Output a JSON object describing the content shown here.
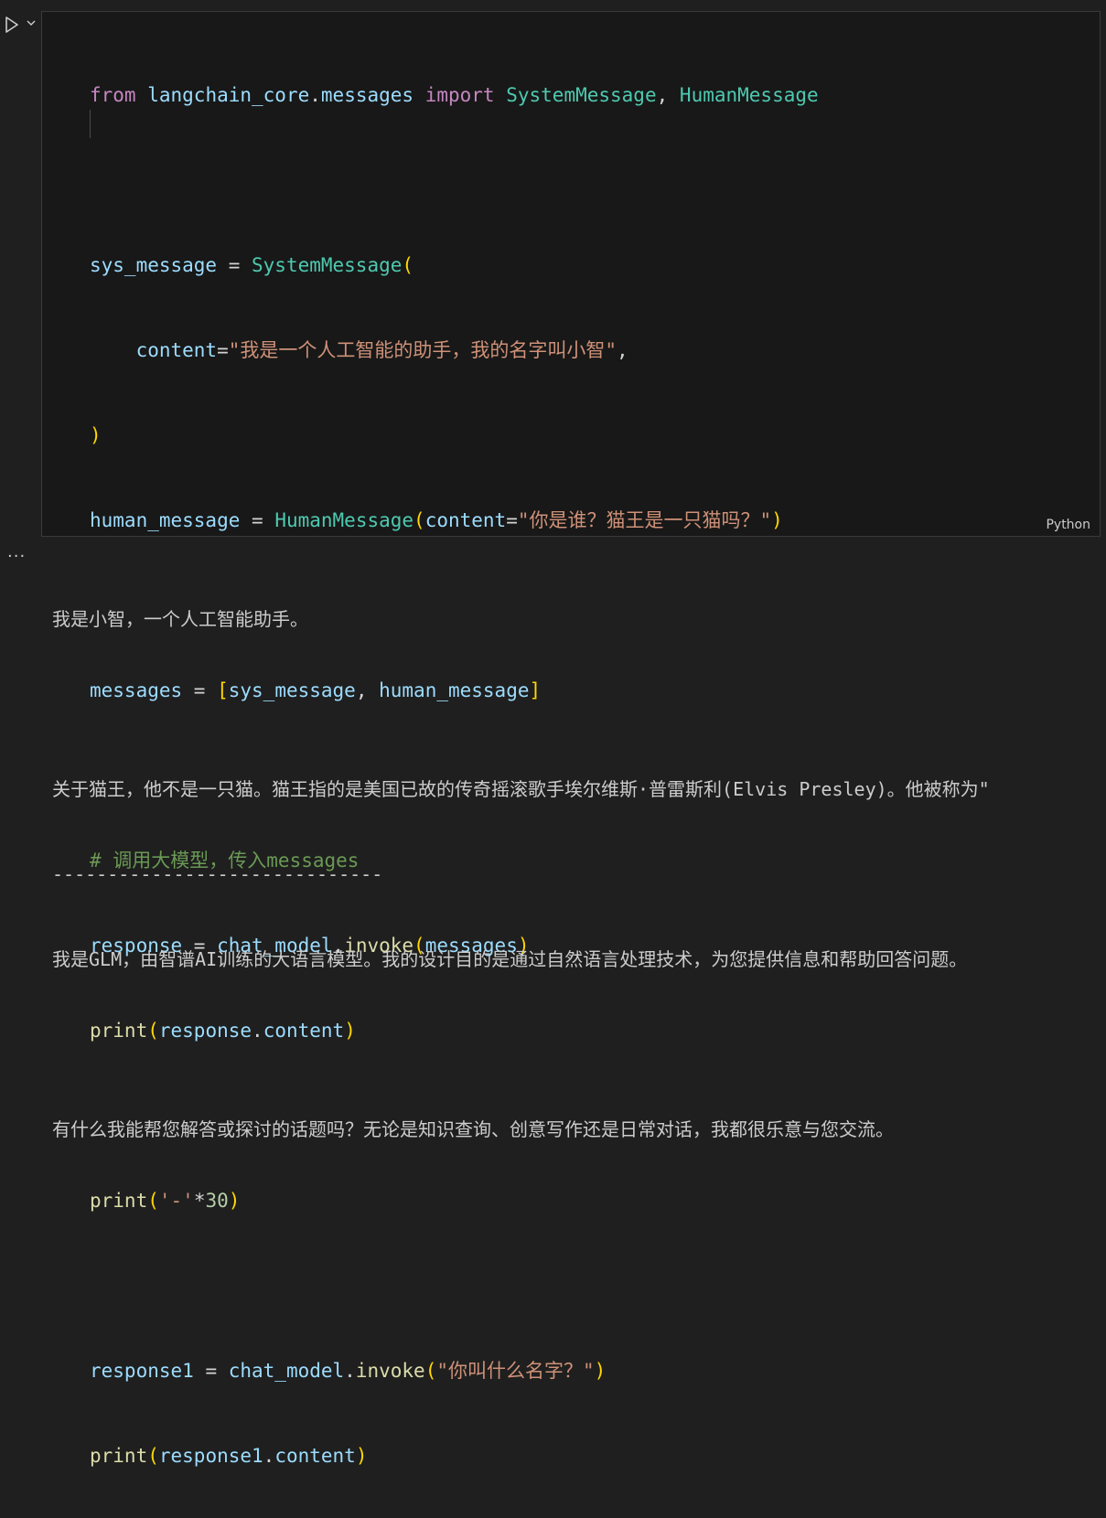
{
  "cell": {
    "language": "Python",
    "code": {
      "l1_from": "from",
      "l1_mod": "langchain_core",
      "l1_dot": ".",
      "l1_mod2": "messages",
      "l1_import": "import",
      "l1_cls1": "SystemMessage",
      "l1_comma": ",",
      "l1_cls2": "HumanMessage",
      "l3_var": "sys_message",
      "l3_eq": " = ",
      "l3_cls": "SystemMessage",
      "l3_paren": "(",
      "l4_param": "content",
      "l4_eq": "=",
      "l4_str": "\"我是一个人工智能的助手，我的名字叫小智\"",
      "l4_comma": ",",
      "l5_paren": ")",
      "l6_var": "human_message",
      "l6_eq": " = ",
      "l6_cls": "HumanMessage",
      "l6_open": "(",
      "l6_param": "content",
      "l6_eq2": "=",
      "l6_str": "\"你是谁？猫王是一只猫吗？\"",
      "l6_close": ")",
      "l8_var": "messages",
      "l8_eq": " = ",
      "l8_open": "[",
      "l8_v1": "sys_message",
      "l8_comma": ", ",
      "l8_v2": "human_message",
      "l8_close": "]",
      "l10_comment": "# 调用大模型，传入messages",
      "l11_var": "response",
      "l11_eq": " = ",
      "l11_obj": "chat_model",
      "l11_dot": ".",
      "l11_fn": "invoke",
      "l11_open": "(",
      "l11_arg": "messages",
      "l11_close": ")",
      "l12_fn": "print",
      "l12_open": "(",
      "l12_obj": "response",
      "l12_dot": ".",
      "l12_attr": "content",
      "l12_close": ")",
      "l14_fn": "print",
      "l14_open": "(",
      "l14_str": "'-'",
      "l14_op": "*",
      "l14_num": "30",
      "l14_close": ")",
      "l16_var": "response1",
      "l16_eq": " = ",
      "l16_obj": "chat_model",
      "l16_dot": ".",
      "l16_fn": "invoke",
      "l16_open": "(",
      "l16_str": "\"你叫什么名字？\"",
      "l16_close": ")",
      "l17_fn": "print",
      "l17_open": "(",
      "l17_obj": "response1",
      "l17_dot": ".",
      "l17_attr": "content",
      "l17_close": ")"
    }
  },
  "output": {
    "lines": [
      "我是小智，一个人工智能助手。",
      "",
      "关于猫王，他不是一只猫。猫王指的是美国已故的传奇摇滚歌手埃尔维斯·普雷斯利(Elvis Presley)。他被称为\"",
      "------------------------------",
      "我是GLM，由智谱AI训练的大语言模型。我的设计目的是通过自然语言处理技术，为您提供信息和帮助回答问题。",
      "",
      "有什么我能帮您解答或探讨的话题吗？无论是知识查询、创意写作还是日常对话，我都很乐意与您交流。"
    ]
  },
  "icons": {
    "run": "play-icon",
    "chevron": "chevron-down-icon",
    "more": "ellipsis-icon"
  }
}
